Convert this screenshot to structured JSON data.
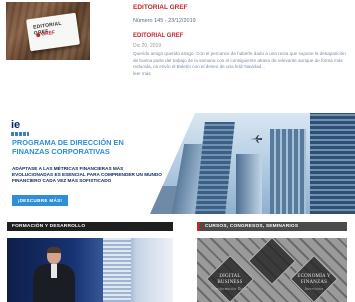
{
  "editorial": {
    "card_title": "EDITORIAL GREF",
    "card_logo": "GREF",
    "heading": "EDITORIAL GREF",
    "number_line": "Número 145 - 23/12/2019",
    "heading2": "EDITORIAL GREF",
    "date": "Dic 20, 2019",
    "body": "Querido amigo querido amigo: Con el percance de haberle dado a una recta que supone la desaparición de buena parte del trabajo de la semana con el consiguiente atraso de relevante aunque de forma más reducida, os envío el Boletín con el deseo de una feliz Navidad...",
    "more": "leer más"
  },
  "banner": {
    "logo_text": "ie",
    "title": "PROGRAMA DE DIRECCIÓN EN FINANZAS CORPORATIVAS",
    "subtitle": "ADÁPTASE A LAS MÉTRICAS FINANCIERAS MÁS EVOLUCIONADAS ES ESENCIAL PARA COMPRENDER UN MUNDO FINANCIERO CADA VEZ MÁS SOFISTICADO",
    "button_label": "¡DESCUBRE MÁS!"
  },
  "sections": {
    "left_title": "FORMACIÓN Y DESARROLLO",
    "right_title": "CURSOS, CONGRESOS, SEMINARIOS",
    "right_panel": {
      "items": [
        {
          "label": "DIGITAL BUSINESS",
          "sub": "Transformación Digital"
        },
        {
          "label": "",
          "sub": ""
        },
        {
          "label": "ECONOMÍA Y FINANZAS",
          "sub": "Inversiones"
        }
      ]
    }
  },
  "colors": {
    "accent_red": "#c0272d",
    "ie_blue": "#2f8fd6",
    "ie_navy": "#0d2a66"
  }
}
